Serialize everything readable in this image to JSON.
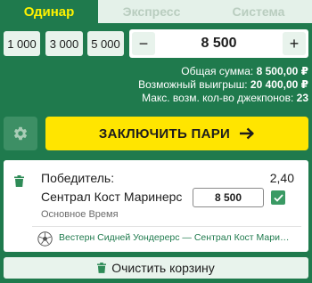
{
  "tabs": [
    {
      "label": "Одинар",
      "active": true
    },
    {
      "label": "Экспресс",
      "active": false
    },
    {
      "label": "Система",
      "active": false
    }
  ],
  "quick_amounts": [
    "1 000",
    "3 000",
    "5 000"
  ],
  "stepper": {
    "minus": "−",
    "plus": "+",
    "value": "8 500"
  },
  "summary": {
    "total_label": "Общая сумма:",
    "total_value": "8 500,00 ₽",
    "win_label": "Возможный выигрыш:",
    "win_value": "20 400,00 ₽",
    "jackpot_label": "Макс. возм. кол-во джекпонов:",
    "jackpot_value": "23"
  },
  "bet_button": {
    "label": "ЗАКЛЮЧИТЬ ПАРИ"
  },
  "coupon": {
    "market": "Победитель:",
    "odds": "2,40",
    "selection": "Сентрал Кост Маринерс",
    "stake": "8 500",
    "period": "Основное Время",
    "match": "Вестерн Сидней Уондерерс — Сентрал Кост Маринерс"
  },
  "clear_button": {
    "label": "Очистить корзину"
  },
  "icons": {
    "settings": "gear-icon",
    "bet_arrow": "arrow-right-icon",
    "remove": "trash-icon",
    "checkbox": "check-icon",
    "sport": "soccer-ball-icon",
    "clear": "trash-icon"
  },
  "colors": {
    "background": "#1f7a4d",
    "accent": "#ffe500",
    "active_tab_text": "#fff200",
    "light_button": "#e8f3ec"
  }
}
